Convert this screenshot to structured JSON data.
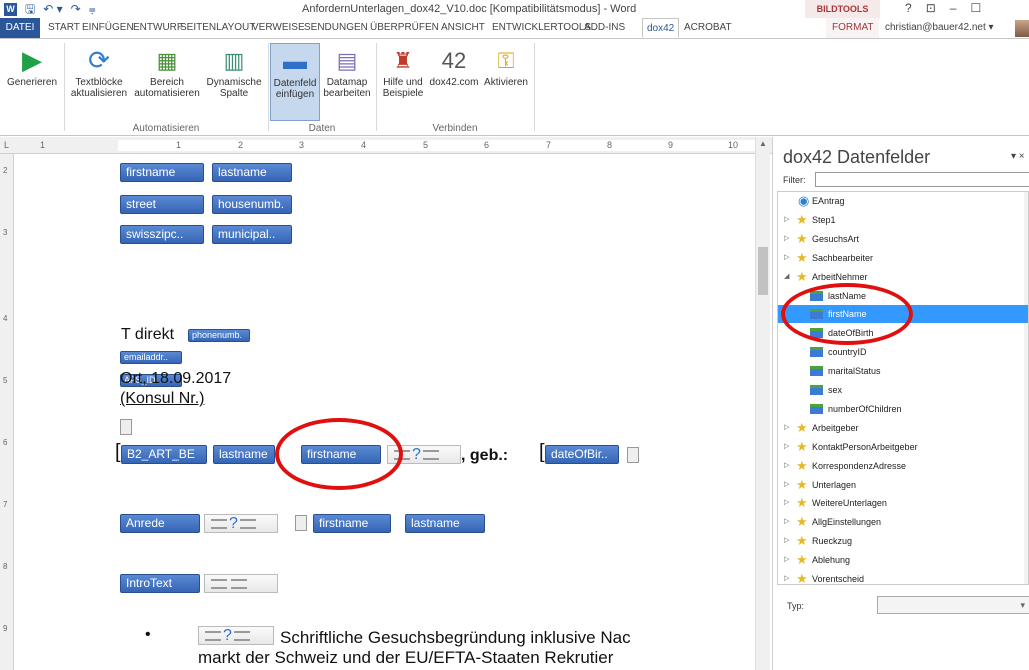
{
  "window": {
    "title": "AnfordernUnterlagen_dox42_V10.doc [Kompatibilitätsmodus] - Word",
    "context_tools": "BILDTOOLS",
    "help": "?",
    "restore": "⊡",
    "minimize": "–",
    "maximize": "☐"
  },
  "qat": {
    "word": "W",
    "save": "🖫",
    "undo": "↶ ▾",
    "redo": "↷",
    "customize": "⩦"
  },
  "tabs": [
    "DATEI",
    "START",
    "EINFÜGEN",
    "ENTWURF",
    "SEITENLAYOUT",
    "VERWEISE",
    "SENDUNGEN",
    "ÜBERPRÜFEN",
    "ANSICHT",
    "ENTWICKLERTOOLS",
    "ADD-INS",
    "dox42",
    "ACROBAT",
    "FORMAT"
  ],
  "account": "christian@bauer42.net ▾",
  "ribbon": {
    "buttons": {
      "generieren": "Generieren",
      "textbloecke1": "Textblöcke",
      "textbloecke2": "aktualisieren",
      "bereich1": "Bereich",
      "bereich2": "automatisieren",
      "dynamische1": "Dynamische",
      "dynamische2": "Spalte",
      "datenfeld1": "Datenfeld",
      "datenfeld2": "einfügen",
      "datamap1": "Datamap",
      "datamap2": "bearbeiten",
      "hilfe1": "Hilfe und",
      "hilfe2": "Beispiele",
      "dox42com": "dox42.com",
      "aktivieren": "Aktivieren",
      "num42": "42"
    },
    "groups": {
      "automatisieren": "Automatisieren",
      "daten": "Daten",
      "verbinden": "Verbinden"
    }
  },
  "ruler": {
    "corner": "L",
    "numbers": [
      "1",
      "1",
      "2",
      "3",
      "4",
      "5",
      "6",
      "7",
      "8",
      "9",
      "10"
    ],
    "vnumbers": [
      "2",
      "3",
      "4",
      "5",
      "6",
      "7",
      "8",
      "9"
    ]
  },
  "document": {
    "fields": {
      "firstname": "firstname",
      "lastname": "lastname",
      "street": "street",
      "housenumb": "housenumb.",
      "swisszipc": "swisszipc..",
      "municipal": "municipal..",
      "phonenumb": "phonenumb.",
      "emailaddr": "emailaddr..",
      "afs_id": "AFS_ID",
      "b2_art": "B2_ART_BE",
      "dateofbir": "dateOfBir..",
      "anrede": "Anrede",
      "introtext": "IntroText"
    },
    "text": {
      "t_direkt": "T direkt",
      "ort": "Ort, 18.09.2017",
      "konsul": "(Konsul Nr.)",
      "geb": ", geb.:",
      "bracket": "[",
      "bullet": "•",
      "para1": "Schriftliche Gesuchsbegründung inklusive Nac",
      "para2": "markt der Schweiz und der EU/EFTA-Staaten Rekrutier",
      "q": "?"
    }
  },
  "pane": {
    "title": "dox42 Datenfelder",
    "close": "▾ ×",
    "filter_label": "Filter:",
    "filter_value": "",
    "typ_label": "Typ:",
    "typ_value": "▾",
    "tree": [
      {
        "label": "EAntrag",
        "icon": "info",
        "expand": ""
      },
      {
        "label": "Step1",
        "icon": "star",
        "expand": "▷"
      },
      {
        "label": "GesuchsArt",
        "icon": "star",
        "expand": "▷"
      },
      {
        "label": "Sachbearbeiter",
        "icon": "star",
        "expand": "▷"
      },
      {
        "label": "ArbeitNehmer",
        "icon": "star",
        "expand": "◢"
      },
      {
        "label": "lastName",
        "icon": "field",
        "expand": ""
      },
      {
        "label": "firstName",
        "icon": "field",
        "expand": "",
        "selected": true
      },
      {
        "label": "dateOfBirth",
        "icon": "field",
        "expand": ""
      },
      {
        "label": "countryID",
        "icon": "field",
        "expand": ""
      },
      {
        "label": "maritalStatus",
        "icon": "field",
        "expand": ""
      },
      {
        "label": "sex",
        "icon": "field",
        "expand": ""
      },
      {
        "label": "numberOfChildren",
        "icon": "field",
        "expand": ""
      },
      {
        "label": "Arbeitgeber",
        "icon": "star",
        "expand": "▷"
      },
      {
        "label": "KontaktPersonArbeitgeber",
        "icon": "star",
        "expand": "▷"
      },
      {
        "label": "KorrespondenzAdresse",
        "icon": "star",
        "expand": "▷"
      },
      {
        "label": "Unterlagen",
        "icon": "star",
        "expand": "▷"
      },
      {
        "label": "WeitereUnterlagen",
        "icon": "star",
        "expand": "▷"
      },
      {
        "label": "AllgEinstellungen",
        "icon": "star",
        "expand": "▷"
      },
      {
        "label": "Rueckzug",
        "icon": "star",
        "expand": "▷"
      },
      {
        "label": "Ablehung",
        "icon": "star",
        "expand": "▷"
      },
      {
        "label": "Vorentscheid",
        "icon": "star",
        "expand": "▷"
      }
    ]
  }
}
